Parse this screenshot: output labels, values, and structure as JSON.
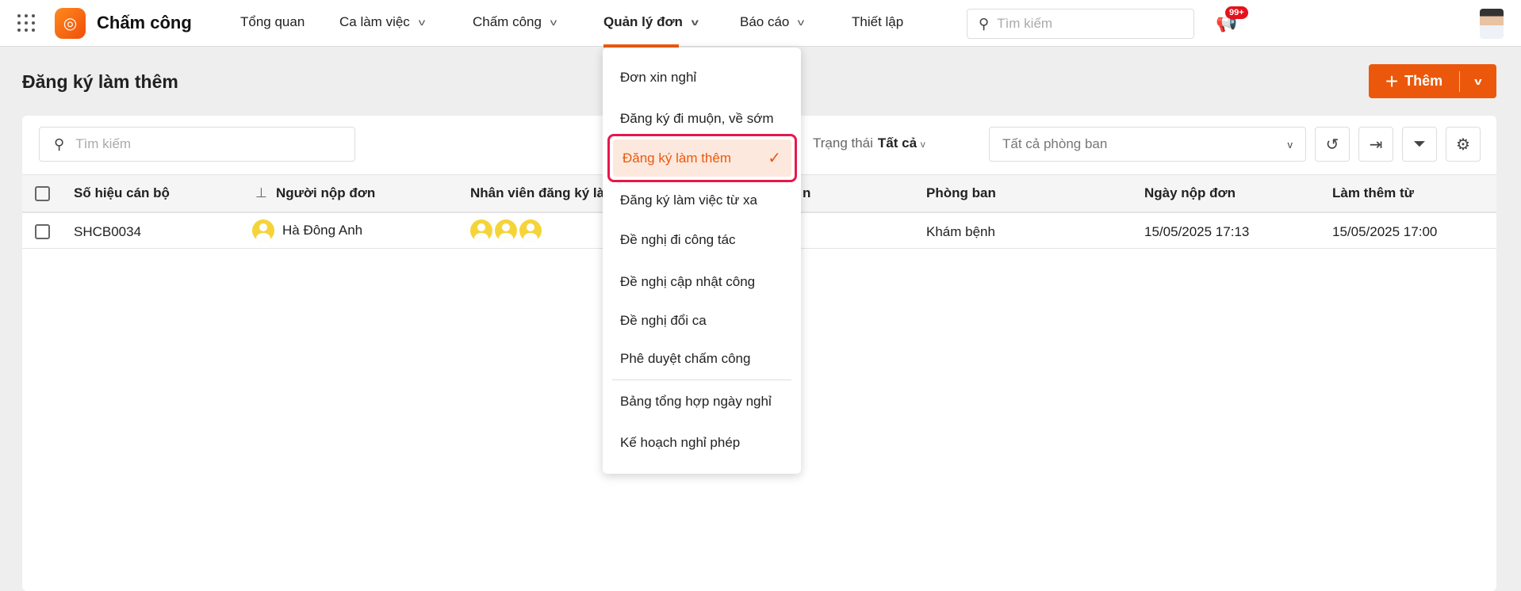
{
  "header": {
    "app_title": "Chấm công",
    "nav": [
      {
        "label": "Tổng quan"
      },
      {
        "label": "Ca làm việc"
      },
      {
        "label": "Chấm công"
      },
      {
        "label": "Quản lý đơn"
      },
      {
        "label": "Báo cáo"
      },
      {
        "label": "Thiết lập"
      }
    ],
    "search_placeholder": "Tìm kiếm",
    "notification_count": "99+"
  },
  "page": {
    "title": "Đăng ký làm thêm",
    "add_label": "Thêm"
  },
  "toolbar": {
    "search_placeholder": "Tìm kiếm",
    "status_label": "Trạng thái",
    "status_value": "Tất cả",
    "department": "Tất cả phòng ban"
  },
  "table": {
    "columns": [
      "Số hiệu cán bộ",
      "Người nộp đơn",
      "Nhân viên đăng ký là",
      "Phòng ban",
      "Ngày nộp đơn",
      "Làm thêm từ"
    ],
    "partial_column_tail": "n",
    "rows": [
      {
        "code": "SHCB0034",
        "submitter": "Hà Đông Anh",
        "department": "Khám bệnh",
        "submitted": "15/05/2025 17:13",
        "from": "15/05/2025 17:00"
      }
    ]
  },
  "menu": {
    "items": [
      "Đơn xin nghỉ",
      "Đăng ký đi muộn, về sớm",
      "Đăng ký làm thêm",
      "Đăng ký làm việc từ xa",
      "Đề nghị đi công tác",
      "Đề nghị cập nhật công",
      "Đề nghị đổi ca",
      "Phê duyệt chấm công",
      "Bảng tổng hợp ngày nghỉ",
      "Kế hoạch nghỉ phép"
    ],
    "selected": "Đăng ký làm thêm"
  },
  "colors": {
    "accent": "#ec580b",
    "highlight_border": "#e8174a",
    "avatar": "#f5d43a"
  }
}
